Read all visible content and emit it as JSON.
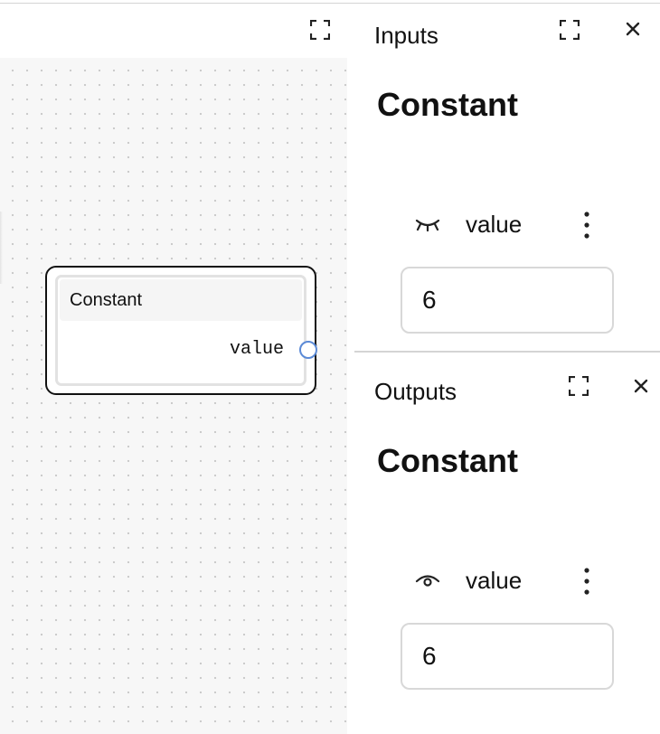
{
  "canvas": {
    "node": {
      "title": "Constant",
      "output_label": "value"
    }
  },
  "inputs_panel": {
    "title": "Inputs",
    "heading": "Constant",
    "field": {
      "label": "value",
      "visibility_icon": "eye-closed-icon",
      "value": "6"
    }
  },
  "outputs_panel": {
    "title": "Outputs",
    "heading": "Constant",
    "field": {
      "label": "value",
      "visibility_icon": "eye-open-icon",
      "value": "6"
    }
  },
  "colors": {
    "port_ring": "#5b8ad6",
    "canvas_bg": "#f7f7f7",
    "border": "#d8d8d8"
  }
}
